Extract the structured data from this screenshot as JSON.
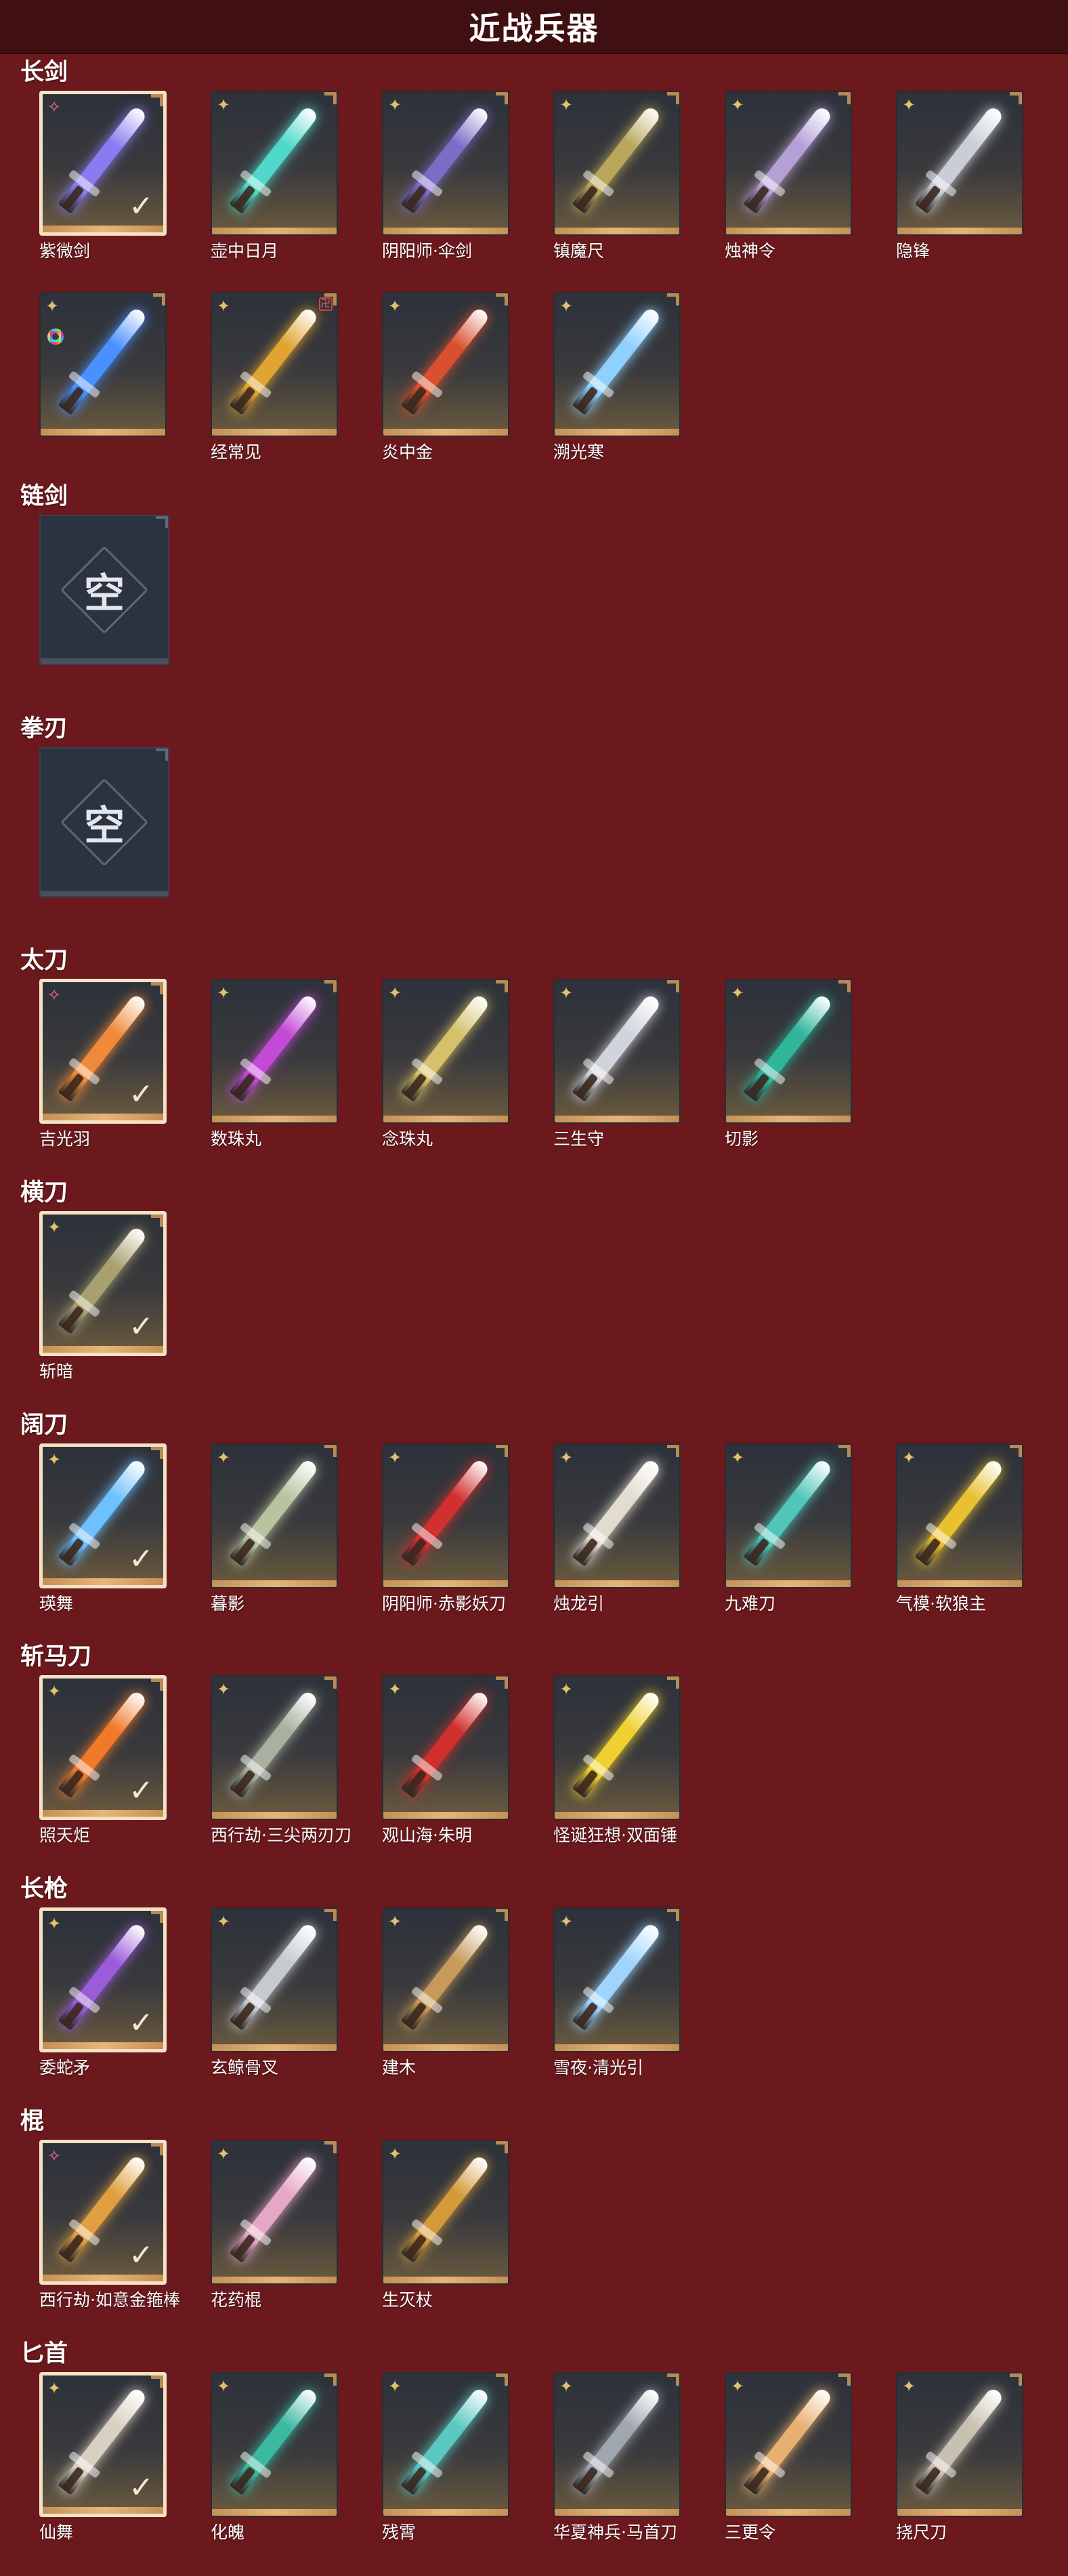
{
  "page_title": "近战兵器",
  "empty_label": "空",
  "check_mark": "✓",
  "badges": {
    "gold": "✦",
    "pink": "✧",
    "corner": "卍"
  },
  "sections": [
    {
      "title": "长剑",
      "items": [
        {
          "name": "紫微剑",
          "badge": "pink",
          "equipped": true,
          "color": "#8a7cf0"
        },
        {
          "name": "壶中日月",
          "badge": "gold",
          "equipped": false,
          "color": "#4fd8c9"
        },
        {
          "name": "阴阳师·伞剑",
          "badge": "gold",
          "equipped": false,
          "color": "#7b6cc6"
        },
        {
          "name": "镇魔尺",
          "badge": "gold",
          "equipped": false,
          "color": "#b8a65a"
        },
        {
          "name": "烛神令",
          "badge": "gold",
          "equipped": false,
          "color": "#b5a0d6"
        },
        {
          "name": "隐锋",
          "badge": "gold",
          "equipped": false,
          "color": "#c9cdd6"
        },
        {
          "name": "",
          "badge": "gold",
          "equipped": false,
          "color": "#4a90ff",
          "rainbow": true
        },
        {
          "name": "经常见",
          "badge": "gold",
          "equipped": false,
          "color": "#e0a431",
          "corner": true
        },
        {
          "name": "炎中金",
          "badge": "gold",
          "equipped": false,
          "color": "#d8502e"
        },
        {
          "name": "溯光寒",
          "badge": "gold",
          "equipped": false,
          "color": "#8fd0ff"
        }
      ]
    },
    {
      "title": "链剑",
      "empty": true,
      "items": []
    },
    {
      "title": "拳刃",
      "empty": true,
      "items": []
    },
    {
      "title": "太刀",
      "items": [
        {
          "name": "吉光羽",
          "badge": "pink",
          "equipped": true,
          "color": "#f08a3a"
        },
        {
          "name": "数珠丸",
          "badge": "gold",
          "equipped": false,
          "color": "#c34ad6"
        },
        {
          "name": "念珠丸",
          "badge": "gold",
          "equipped": false,
          "color": "#d6c06b"
        },
        {
          "name": "三生守",
          "badge": "gold",
          "equipped": false,
          "color": "#d2d4dc"
        },
        {
          "name": "切影",
          "badge": "gold",
          "equipped": false,
          "color": "#2fb59a"
        }
      ]
    },
    {
      "title": "横刀",
      "items": [
        {
          "name": "斩暗",
          "badge": "gold",
          "equipped": true,
          "color": "#a8a070"
        }
      ]
    },
    {
      "title": "阔刀",
      "items": [
        {
          "name": "瑛舞",
          "badge": "gold",
          "equipped": true,
          "color": "#6ec0ff"
        },
        {
          "name": "暮影",
          "badge": "gold",
          "equipped": false,
          "color": "#b9c3a0"
        },
        {
          "name": "阴阳师·赤影妖刀",
          "badge": "gold",
          "equipped": false,
          "color": "#d23030"
        },
        {
          "name": "烛龙引",
          "badge": "gold",
          "equipped": false,
          "color": "#e2dcd0"
        },
        {
          "name": "九难刀",
          "badge": "gold",
          "equipped": false,
          "color": "#4fc6b8"
        },
        {
          "name": "气模·软狼主",
          "badge": "gold",
          "equipped": false,
          "color": "#e8c030"
        }
      ]
    },
    {
      "title": "斩马刀",
      "items": [
        {
          "name": "照天炬",
          "badge": "gold",
          "equipped": true,
          "color": "#f07a2a"
        },
        {
          "name": "西行劫·三尖两刃刀",
          "badge": "gold",
          "equipped": false,
          "color": "#a9b0a0"
        },
        {
          "name": "观山海·朱明",
          "badge": "gold",
          "equipped": false,
          "color": "#d0302c"
        },
        {
          "name": "怪诞狂想·双面锤",
          "badge": "gold",
          "equipped": false,
          "color": "#f0d030"
        }
      ]
    },
    {
      "title": "长枪",
      "items": [
        {
          "name": "委蛇矛",
          "badge": "gold",
          "equipped": true,
          "color": "#9a5cd8"
        },
        {
          "name": "玄鲸骨叉",
          "badge": "gold",
          "equipped": false,
          "color": "#c6cad0"
        },
        {
          "name": "建木",
          "badge": "gold",
          "equipped": false,
          "color": "#c79a5a"
        },
        {
          "name": "雪夜·清光引",
          "badge": "gold",
          "equipped": false,
          "color": "#9fd4ff"
        }
      ]
    },
    {
      "title": "棍",
      "items": [
        {
          "name": "西行劫·如意金箍棒",
          "badge": "pink",
          "equipped": true,
          "color": "#e0a040"
        },
        {
          "name": "花药棍",
          "badge": "gold",
          "equipped": false,
          "color": "#e6a6c6"
        },
        {
          "name": "生灭杖",
          "badge": "gold",
          "equipped": false,
          "color": "#d49a3a"
        }
      ]
    },
    {
      "title": "匕首",
      "items": [
        {
          "name": "仙舞",
          "badge": "gold",
          "equipped": true,
          "color": "#d8d0c0"
        },
        {
          "name": "化魄",
          "badge": "gold",
          "equipped": false,
          "color": "#3ab8a0"
        },
        {
          "name": "残霄",
          "badge": "gold",
          "equipped": false,
          "color": "#5ac8c0"
        },
        {
          "name": "华夏神兵·马首刀",
          "badge": "gold",
          "equipped": false,
          "color": "#a0a6b0"
        },
        {
          "name": "三更令",
          "badge": "gold",
          "equipped": false,
          "color": "#e8b070"
        },
        {
          "name": "挠尺刀",
          "badge": "gold",
          "equipped": false,
          "color": "#c8c0b0"
        }
      ]
    }
  ]
}
